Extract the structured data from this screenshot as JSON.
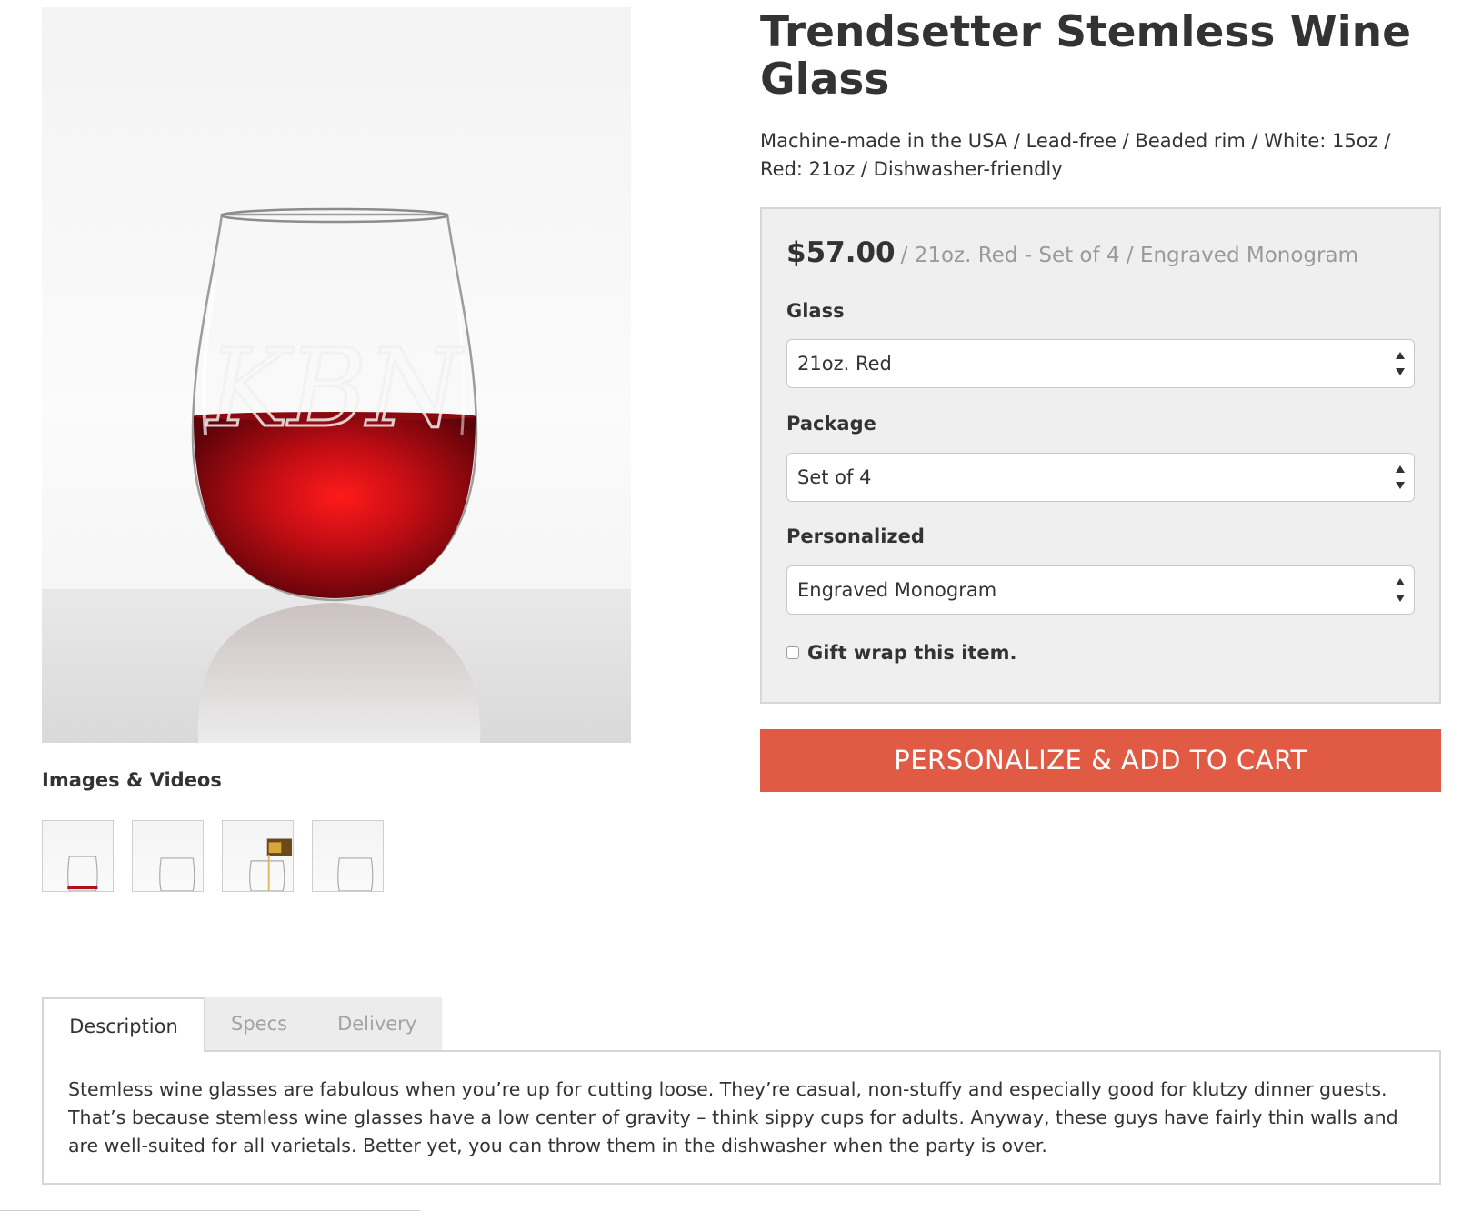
{
  "product": {
    "title": "Trendsetter Stemless Wine Glass",
    "subtitle": "Machine-made in the USA / Lead-free / Beaded rim / White: 15oz / Red: 21oz / Dishwasher-friendly",
    "price": "$57.00",
    "price_detail": "/ 21oz. Red - Set of 4 / Engraved Monogram"
  },
  "media": {
    "section_title": "Images & Videos",
    "main_image_icon": "wine-glass-photo",
    "monogram": "KBN",
    "thumbnails": [
      {
        "icon": "glass-red-wine-thumbnail"
      },
      {
        "icon": "glass-empty-thumbnail"
      },
      {
        "icon": "glass-pouring-thumbnail"
      },
      {
        "icon": "glass-empty-angle-thumbnail"
      }
    ]
  },
  "options": {
    "glass": {
      "label": "Glass",
      "value": "21oz. Red"
    },
    "package": {
      "label": "Package",
      "value": "Set of 4"
    },
    "personalized": {
      "label": "Personalized",
      "value": "Engraved Monogram"
    },
    "gift_wrap": {
      "label": "Gift wrap this item.",
      "checked": false
    }
  },
  "cta": {
    "label": "PERSONALIZE & ADD TO CART"
  },
  "tabs": [
    {
      "label": "Description",
      "active": true
    },
    {
      "label": "Specs",
      "active": false
    },
    {
      "label": "Delivery",
      "active": false
    }
  ],
  "description": "Stemless wine glasses are fabulous when you’re up for cutting loose. They’re casual, non-stuffy and especially good for klutzy dinner guests. That’s because stemless wine glasses have a low center of gravity – think sippy cups for adults. Anyway, these guys have fairly thin walls and are well-suited for all varietals. Better yet, you can throw them in the dishwasher when the party is over.",
  "colors": {
    "accent": "#e05a44",
    "text": "#333333",
    "muted": "#9a9a9a",
    "panel_bg": "#efefef",
    "wine": "#b0101a"
  }
}
